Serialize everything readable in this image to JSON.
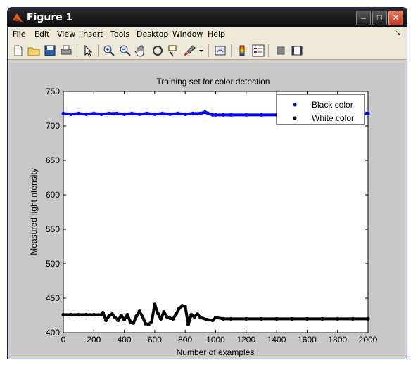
{
  "window": {
    "title": "Figure 1",
    "controls": {
      "minimize": "–",
      "maximize": "□",
      "close": "✕"
    }
  },
  "menubar": {
    "items": [
      {
        "label": "File"
      },
      {
        "label": "Edit"
      },
      {
        "label": "View"
      },
      {
        "label": "Insert"
      },
      {
        "label": "Tools"
      },
      {
        "label": "Desktop"
      },
      {
        "label": "Window"
      },
      {
        "label": "Help"
      }
    ],
    "dock_arrow": "↘"
  },
  "toolbar": {
    "icons": [
      "new-figure-icon",
      "open-file-icon",
      "save-icon",
      "print-icon",
      "edit-plot-arrow-icon",
      "zoom-in-icon",
      "zoom-out-icon",
      "pan-hand-icon",
      "rotate-3d-icon",
      "data-cursor-icon",
      "brush-icon",
      "brush-dropdown-icon",
      "link-plot-icon",
      "insert-colorbar-icon",
      "insert-legend-icon",
      "hide-plot-tools-icon",
      "show-plot-tools-icon"
    ]
  },
  "colors": {
    "black_series": "#0000ff",
    "white_series": "#000000",
    "figure_bg": "#c8c8c8",
    "axes_bg": "#ffffff"
  },
  "chart_data": {
    "type": "scatter",
    "title": "Training set for color detection",
    "xlabel": "Number of examples",
    "ylabel": "Measured light ntensity",
    "xlim": [
      0,
      2000
    ],
    "ylim": [
      400,
      750
    ],
    "xticks": [
      0,
      200,
      400,
      600,
      800,
      1000,
      1200,
      1400,
      1600,
      1800,
      2000
    ],
    "yticks": [
      400,
      450,
      500,
      550,
      600,
      650,
      700,
      750
    ],
    "grid": false,
    "legend_position": "top-right",
    "series": [
      {
        "name": "Black color",
        "color": "#0000ff",
        "x": [
          0,
          50,
          100,
          150,
          200,
          250,
          300,
          350,
          400,
          450,
          500,
          550,
          600,
          650,
          700,
          750,
          800,
          850,
          900,
          930,
          950,
          980,
          1000,
          1050,
          1100,
          1200,
          1300,
          1400,
          1500,
          1600,
          1700,
          1800,
          1900,
          1950,
          1990,
          2000
        ],
        "y": [
          718,
          717,
          718,
          717,
          718,
          717,
          718,
          718,
          717,
          718,
          717,
          718,
          717,
          718,
          717,
          718,
          717,
          718,
          718,
          720,
          718,
          716,
          716,
          716,
          716,
          716,
          716,
          716,
          716,
          716,
          716,
          716,
          716,
          716,
          718,
          718
        ]
      },
      {
        "name": "White color",
        "color": "#000000",
        "x": [
          0,
          50,
          100,
          150,
          200,
          250,
          260,
          280,
          300,
          320,
          340,
          360,
          380,
          400,
          420,
          440,
          460,
          480,
          500,
          520,
          540,
          560,
          580,
          600,
          620,
          640,
          660,
          680,
          700,
          720,
          740,
          760,
          780,
          800,
          820,
          840,
          860,
          880,
          900,
          940,
          980,
          1000,
          1050,
          1100,
          1200,
          1300,
          1400,
          1500,
          1600,
          1700,
          1800,
          1900,
          2000
        ],
        "y": [
          426,
          426,
          426,
          426,
          426,
          426,
          429,
          418,
          424,
          427,
          422,
          418,
          425,
          419,
          426,
          416,
          414,
          424,
          431,
          423,
          413,
          412,
          416,
          441,
          428,
          420,
          430,
          423,
          421,
          420,
          427,
          435,
          439,
          438,
          412,
          426,
          423,
          427,
          422,
          419,
          418,
          422,
          420,
          420,
          420,
          420,
          420,
          420,
          420,
          420,
          420,
          420,
          420
        ]
      }
    ]
  }
}
